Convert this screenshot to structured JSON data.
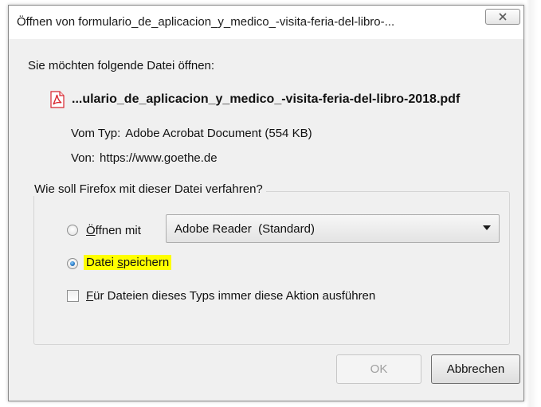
{
  "window": {
    "title": "Öffnen von formulario_de_aplicacion_y_medico_-visita-feria-del-libro-..."
  },
  "prompt": "Sie möchten folgende Datei öffnen:",
  "file": {
    "name": "...ulario_de_aplicacion_y_medico_-visita-feria-del-libro-2018.pdf",
    "type_label": "Vom Typ:",
    "type_value": "Adobe Acrobat Document (554 KB)",
    "from_label": "Von:",
    "from_value": "https://www.goethe.de"
  },
  "action_group": {
    "legend": "Wie soll Firefox mit dieser Datei verfahren?",
    "open_with": {
      "accesskey": "Ö",
      "rest": "ffnen mit",
      "selected": false
    },
    "application_select": {
      "value": "Adobe Reader  (Standard)"
    },
    "save_file": {
      "part1": "Datei ",
      "accesskey": "s",
      "part2": "peichern",
      "selected": true
    },
    "remember": {
      "accesskey": "F",
      "rest": "ür Dateien dieses Typs immer diese Aktion ausführen",
      "checked": false
    }
  },
  "buttons": {
    "ok": "OK",
    "cancel": "Abbrechen"
  },
  "colors": {
    "dialog_bg": "#f0f0f0",
    "highlight": "#ffff00",
    "pdf_red": "#d8262f",
    "radio_selected": "#2a7cc7"
  },
  "icons": {
    "close": "close-icon",
    "file": "pdf-file-icon",
    "dropdown": "chevron-down-icon"
  }
}
